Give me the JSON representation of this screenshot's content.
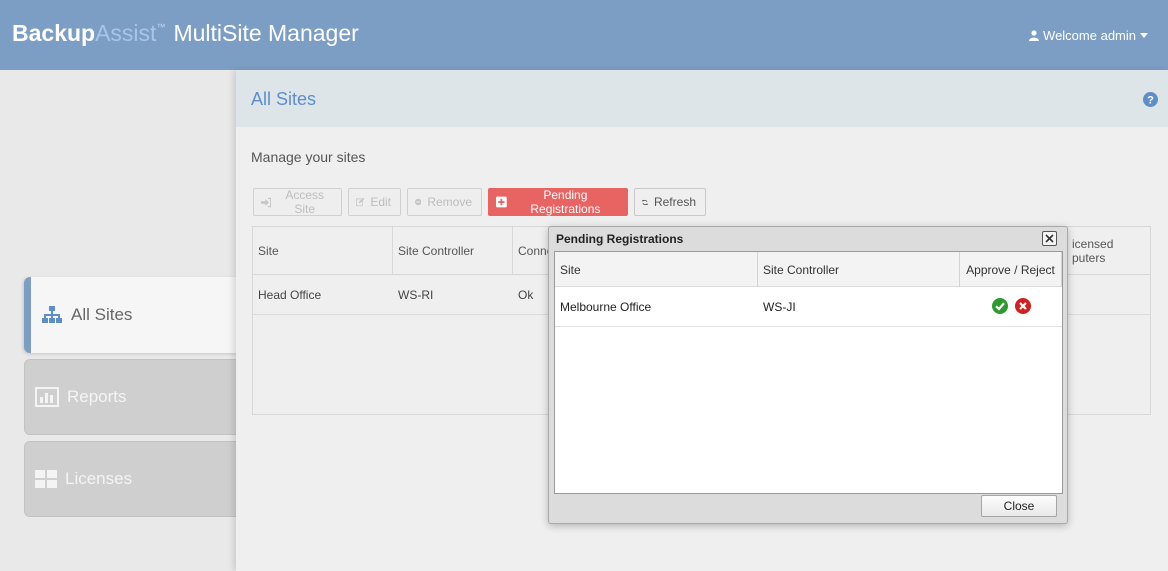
{
  "header": {
    "brand_bold": "Backup",
    "brand_light": "Assist",
    "brand_tm": "™",
    "app_name": "MultiSite Manager",
    "welcome": "Welcome admin",
    "bar_color": "#7d9ec4"
  },
  "sidebar": {
    "items": [
      {
        "label": "All Sites",
        "icon": "sitemap-icon",
        "active": true
      },
      {
        "label": "Reports",
        "icon": "bar-chart-icon",
        "active": false
      },
      {
        "label": "Licenses",
        "icon": "grid-icon",
        "active": false
      }
    ]
  },
  "main": {
    "title": "All Sites",
    "subtitle": "Manage your sites",
    "toolbar": {
      "access_site": "Access Site",
      "edit": "Edit",
      "remove": "Remove",
      "pending": "Pending Registrations",
      "refresh": "Refresh"
    },
    "table": {
      "columns": [
        "Site",
        "Site Controller",
        "Conne",
        "icensed",
        "puters"
      ],
      "rows": [
        {
          "site": "Head Office",
          "controller": "WS-RI",
          "connection": "Ok"
        }
      ]
    }
  },
  "modal": {
    "title": "Pending Registrations",
    "columns": [
      "Site",
      "Site Controller",
      "Approve / Reject"
    ],
    "rows": [
      {
        "site": "Melbourne Office",
        "controller": "WS-JI"
      }
    ],
    "close_label": "Close",
    "approve_color": "#2e9a2e",
    "reject_color": "#d11f1f"
  }
}
